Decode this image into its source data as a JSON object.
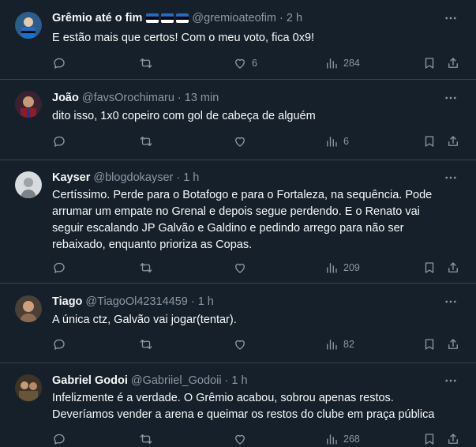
{
  "tweets": [
    {
      "name": "Grêmio até o fim",
      "flags": 3,
      "handle": "@gremioateofim",
      "time": "2 h",
      "text": "E estão mais que certos! Com o meu voto, fica 0x9!",
      "replies": "",
      "retweets": "",
      "likes": "6",
      "views": "284",
      "avatar_color": "#3a7ab8"
    },
    {
      "name": "João",
      "flags": 0,
      "handle": "@favsOrochimaru",
      "time": "13 min",
      "text": "dito isso, 1x0 copeiro com gol de cabeça de alguém",
      "replies": "",
      "retweets": "",
      "likes": "",
      "views": "6",
      "avatar_color": "#7a2a3a"
    },
    {
      "name": "Kayser",
      "flags": 0,
      "handle": "@blogdokayser",
      "time": "1 h",
      "text": "Certíssimo. Perde para o Botafogo e para o Fortaleza, na sequência. Pode arrumar um empate no Grenal e depois segue perdendo. E o Renato vai seguir escalando JP Galvão e Galdino e pedindo arrego para não ser rebaixado, enquanto prioriza as Copas.",
      "replies": "",
      "retweets": "",
      "likes": "",
      "views": "209",
      "avatar_color": "#cfd3d6"
    },
    {
      "name": "Tiago",
      "flags": 0,
      "handle": "@TiagoOl42314459",
      "time": "1 h",
      "text": "A única ctz, Galvão vai jogar(tentar).",
      "replies": "",
      "retweets": "",
      "likes": "",
      "views": "82",
      "avatar_color": "#8a6a52"
    },
    {
      "name": "Gabriel Godoi",
      "flags": 0,
      "handle": "@Gabriiel_Godoii",
      "time": "1 h",
      "text": "Infelizmente é a verdade. O Grêmio acabou, sobrou apenas restos. Deveríamos vender a arena e queimar os restos do clube em praça pública",
      "replies": "",
      "retweets": "",
      "likes": "",
      "views": "268",
      "avatar_color": "#5a4630"
    }
  ],
  "separator": "·"
}
